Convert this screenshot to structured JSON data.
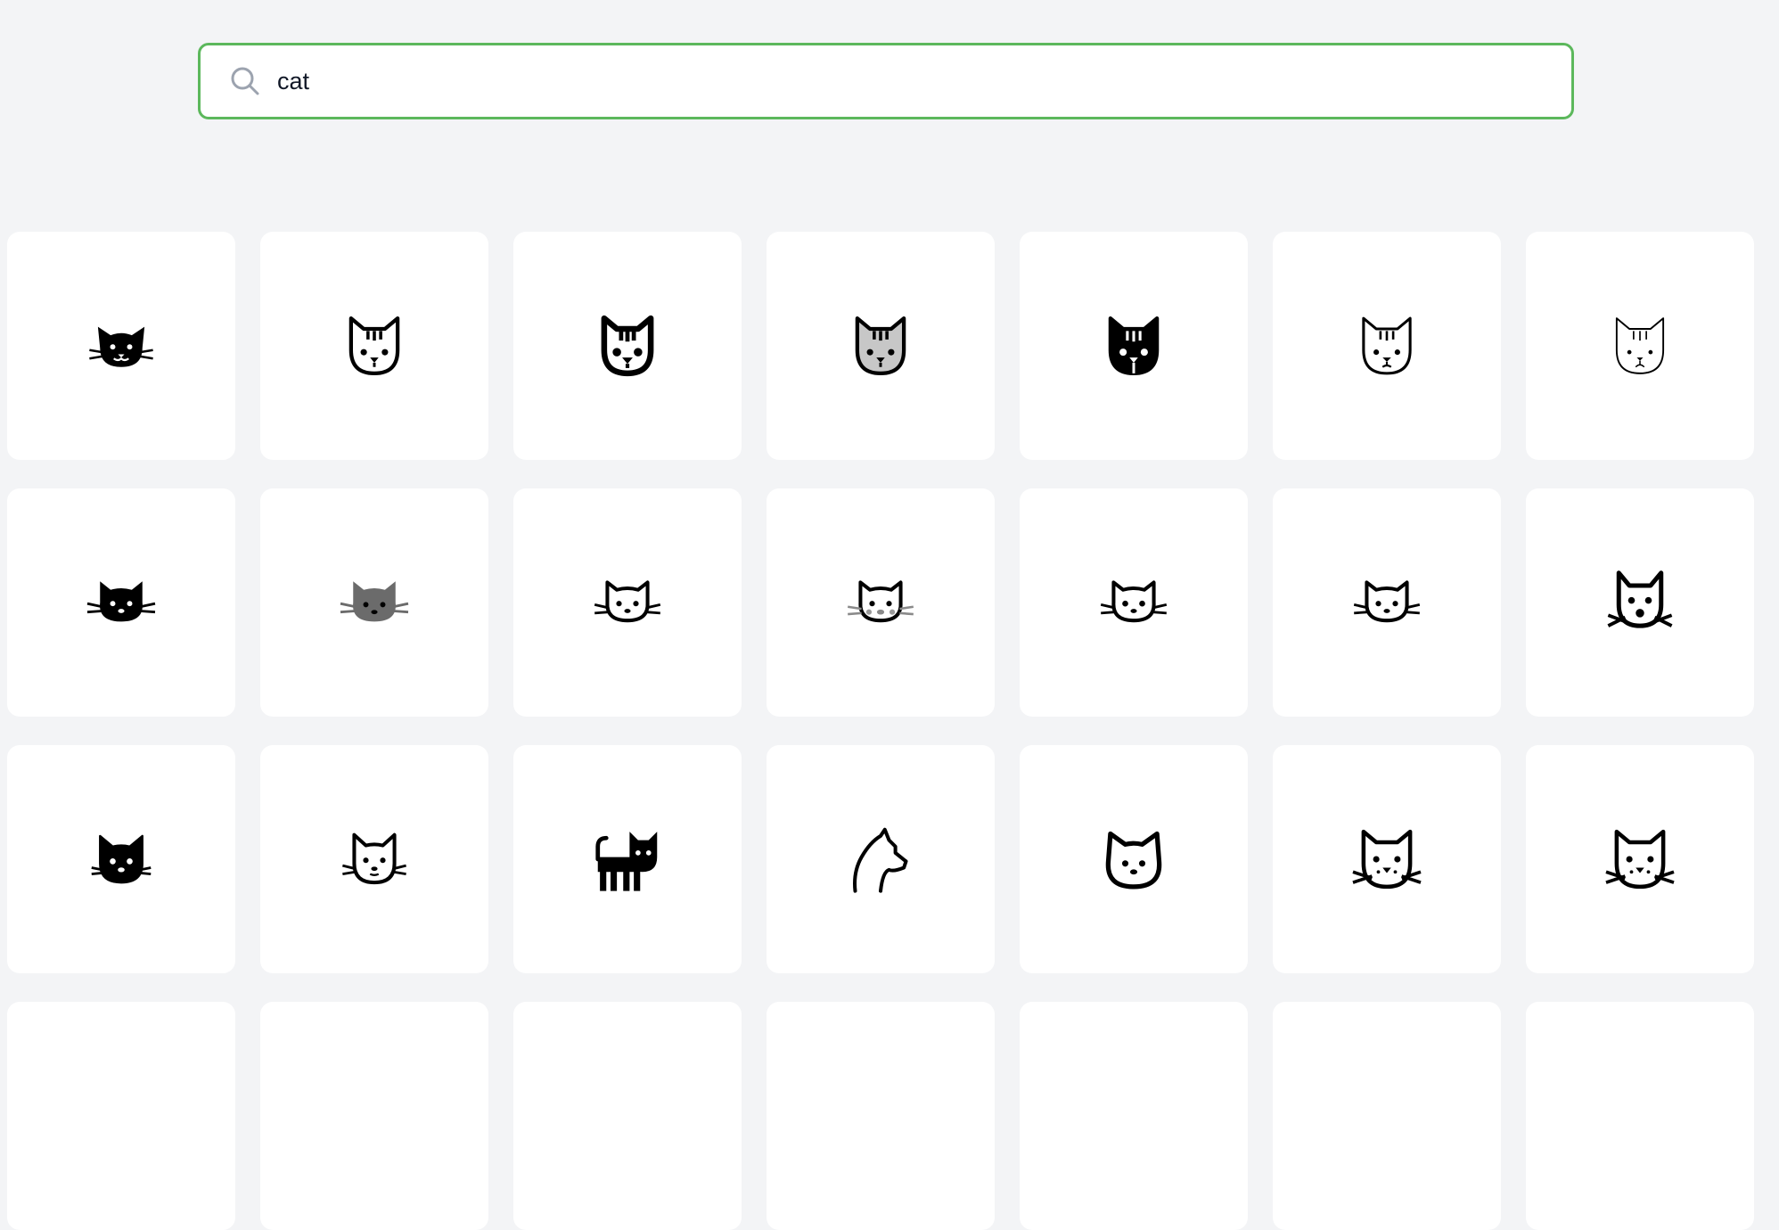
{
  "search": {
    "value": "cat",
    "placeholder": "Search icons"
  },
  "accent_color": "#5cb85c",
  "icons": [
    {
      "name": "cat-face-filled-smile-icon",
      "style": "filled"
    },
    {
      "name": "cat-face-tabby-outline-icon",
      "style": "outline"
    },
    {
      "name": "cat-face-tabby-bold-outline-icon",
      "style": "outline-bold"
    },
    {
      "name": "cat-face-tabby-gray-icon",
      "style": "gray"
    },
    {
      "name": "cat-face-tabby-filled-icon",
      "style": "filled"
    },
    {
      "name": "cat-face-tabby-thin-outline-icon",
      "style": "outline-thin"
    },
    {
      "name": "cat-face-tabby-light-outline-icon",
      "style": "outline-light"
    },
    {
      "name": "cat-face-whiskers-filled-icon",
      "style": "filled"
    },
    {
      "name": "cat-face-whiskers-gray-icon",
      "style": "gray"
    },
    {
      "name": "cat-face-whiskers-outline-icon",
      "style": "outline"
    },
    {
      "name": "cat-face-whiskers-outline-gray-nose-icon",
      "style": "outline-gray"
    },
    {
      "name": "cat-face-whiskers-outline-alt-icon",
      "style": "outline"
    },
    {
      "name": "cat-face-whiskers-outline-alt2-icon",
      "style": "outline"
    },
    {
      "name": "cat-face-surprised-outline-icon",
      "style": "outline"
    },
    {
      "name": "cat-face-rounded-filled-icon",
      "style": "filled"
    },
    {
      "name": "cat-face-simple-outline-icon",
      "style": "outline"
    },
    {
      "name": "cat-full-body-filled-icon",
      "style": "filled"
    },
    {
      "name": "cat-silhouette-outline-icon",
      "style": "outline"
    },
    {
      "name": "cat-face-round-outline-icon",
      "style": "outline"
    },
    {
      "name": "cat-face-spotted-outline-icon",
      "style": "outline"
    },
    {
      "name": "cat-face-spotted-outline-alt-icon",
      "style": "outline"
    }
  ]
}
